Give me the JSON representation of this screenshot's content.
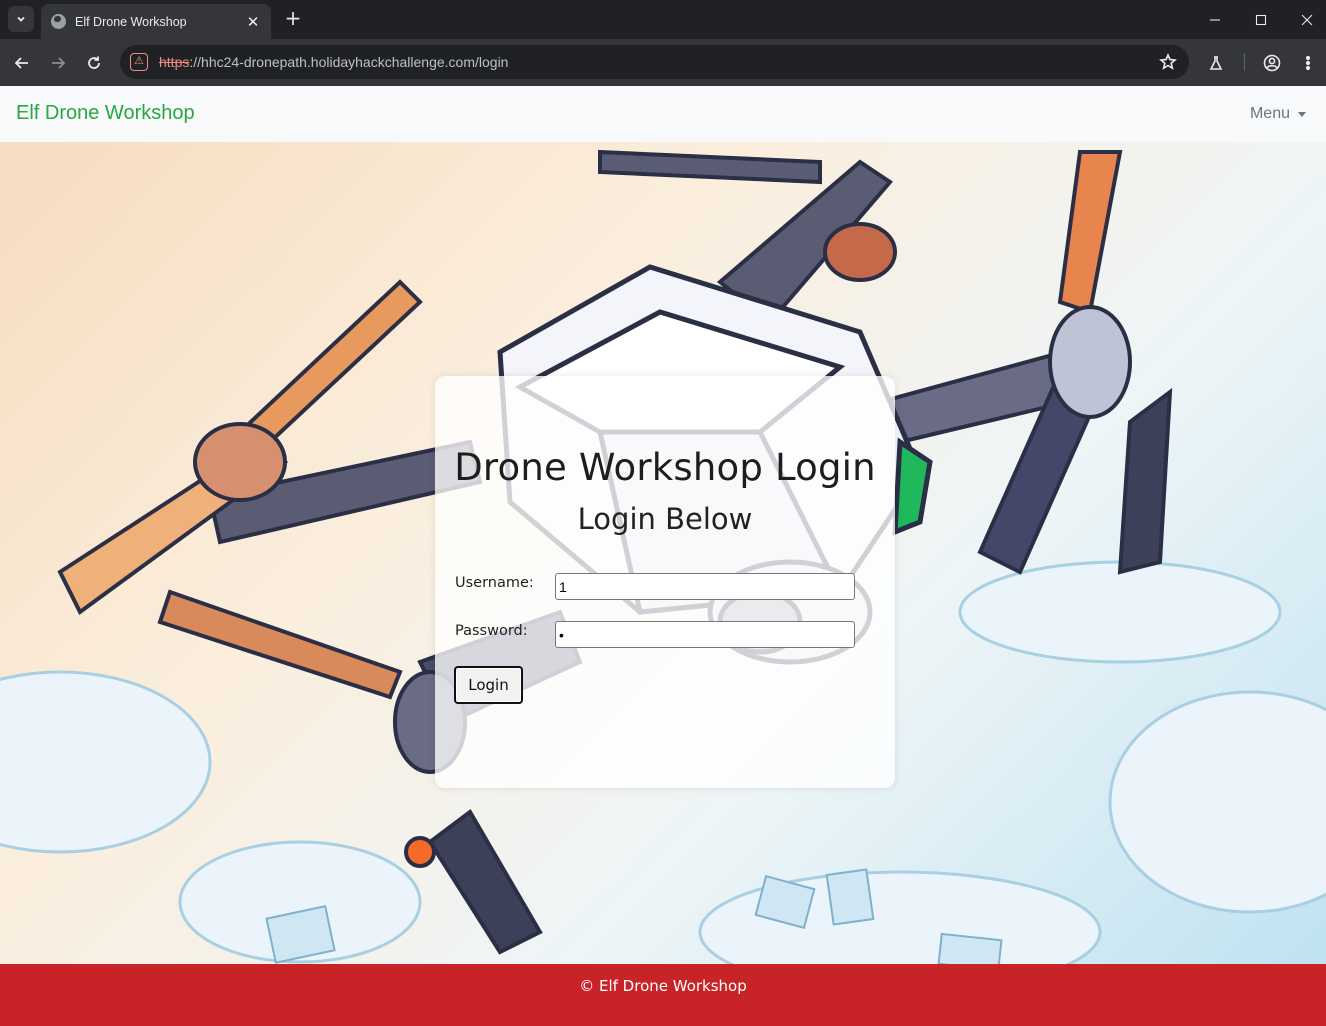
{
  "browser": {
    "tab_title": "Elf Drone Workshop",
    "url_scheme": "https",
    "url_rest": "://hhc24-dronepath.holidayhackchallenge.com/login",
    "url_host": "hhc24-dronepath.holidayhackchallenge.com",
    "url_path": "/login",
    "new_tab_glyph": "+",
    "close_tab_glyph": "✕"
  },
  "navbar": {
    "brand": "Elf Drone Workshop",
    "menu_label": "Menu"
  },
  "login": {
    "title": "Drone Workshop Login",
    "subtitle": "Login Below",
    "username_label": "Username:",
    "username_value": "1",
    "password_label": "Password:",
    "password_value": "1",
    "submit_label": "Login"
  },
  "footer": {
    "text": "© Elf Drone Workshop"
  },
  "colors": {
    "brand_green": "#28a745",
    "footer_red": "#c82326",
    "insecure_red": "#f28b82"
  },
  "icons": {
    "tab_search": "chevron-down-icon",
    "favicon": "globe-icon",
    "back": "arrow-left-icon",
    "forward": "arrow-right-icon",
    "reload": "reload-icon",
    "site_info": "not-secure-icon",
    "bookmark": "star-icon",
    "labs": "flask-icon",
    "profile": "profile-icon",
    "more": "more-vert-icon"
  }
}
